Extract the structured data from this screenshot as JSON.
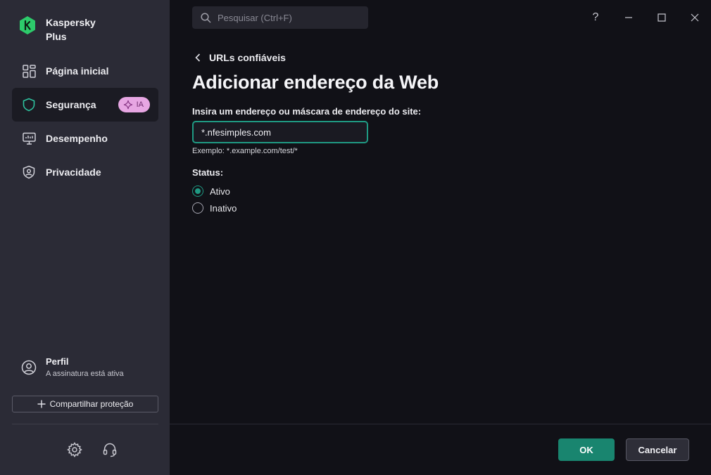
{
  "app": {
    "name": "Kaspersky Plus",
    "brand_color": "#2dcb6b"
  },
  "sidebar": {
    "items": [
      {
        "label": "Página inicial",
        "icon": "dashboard-icon"
      },
      {
        "label": "Segurança",
        "icon": "shield-icon",
        "active": true,
        "badge": "IA"
      },
      {
        "label": "Desempenho",
        "icon": "monitor-icon"
      },
      {
        "label": "Privacidade",
        "icon": "privacy-shield-icon"
      }
    ],
    "profile": {
      "title": "Perfil",
      "subtitle": "A assinatura está ativa"
    },
    "share_label": "Compartilhar proteção"
  },
  "search": {
    "placeholder": "Pesquisar (Ctrl+F)"
  },
  "window": {
    "help": "?"
  },
  "page": {
    "back_label": "URLs confiáveis",
    "title": "Adicionar endereço da Web",
    "field_label": "Insira um endereço ou máscara de endereço do site:",
    "field_value": "*.nfesimples.com",
    "hint": "Exemplo: *.example.com/test/*",
    "status_label": "Status:",
    "status_options": [
      {
        "label": "Ativo",
        "checked": true
      },
      {
        "label": "Inativo",
        "checked": false
      }
    ]
  },
  "footer": {
    "ok_label": "OK",
    "cancel_label": "Cancelar"
  },
  "colors": {
    "accent": "#1f9a83",
    "ok_button": "#19856f",
    "ai_badge": "#e7a6e3"
  }
}
